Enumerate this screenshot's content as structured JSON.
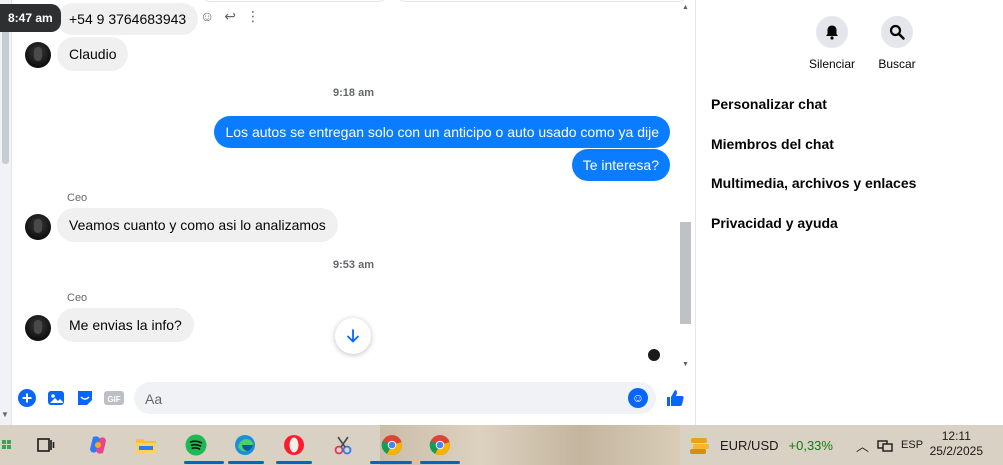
{
  "chat": {
    "tooltip_time": "8:47 am",
    "top_message": "+54 9 3764683943",
    "messages": [
      {
        "sender": "",
        "text": "Claudio"
      },
      {
        "timestamp": "9:18 am"
      },
      {
        "text": "Los autos se entregan solo con un anticipo o auto usado como ya dije"
      },
      {
        "text": "Te interesa?"
      },
      {
        "sender": "Ceo",
        "text": "Veamos cuanto y como asi lo analizamos"
      },
      {
        "timestamp": "9:53 am"
      },
      {
        "sender": "Ceo",
        "text": "Me envias la info?"
      }
    ]
  },
  "composer": {
    "placeholder": "Aa"
  },
  "right_panel": {
    "actions": [
      {
        "label": "Silenciar",
        "icon": "bell-icon"
      },
      {
        "label": "Buscar",
        "icon": "search-icon"
      }
    ],
    "menu": [
      "Personalizar chat",
      "Miembros del chat",
      "Multimedia, archivos y enlaces",
      "Privacidad y ayuda"
    ]
  },
  "taskbar": {
    "ticker_symbol": "EUR/USD",
    "ticker_change": "+0,33%",
    "ticker_color": "#107c10",
    "language": "ESP",
    "time": "12:11",
    "date": "25/2/2025"
  },
  "colors": {
    "accent": "#0866ff",
    "outgoing_bubble": "#0a7cff",
    "incoming_bubble": "#f0f0f0"
  }
}
